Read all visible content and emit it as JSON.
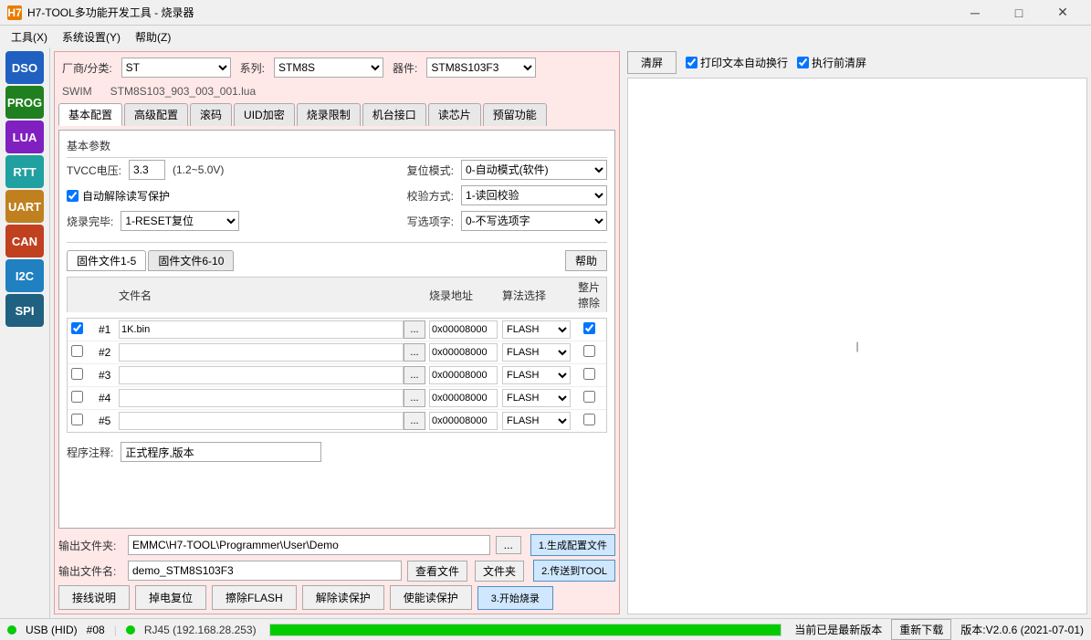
{
  "titleBar": {
    "icon": "H7",
    "title": "H7-TOOL多功能开发工具 - 烧录器",
    "minimizeLabel": "─",
    "maximizeLabel": "□",
    "closeLabel": "✕"
  },
  "menuBar": {
    "items": [
      "工具(X)",
      "系统设置(Y)",
      "帮助(Z)"
    ]
  },
  "sidebar": {
    "items": [
      {
        "label": "DSO",
        "color": "#2060c0"
      },
      {
        "label": "PROG",
        "color": "#208020"
      },
      {
        "label": "LUA",
        "color": "#8020c0"
      },
      {
        "label": "RTT",
        "color": "#20a0a0"
      },
      {
        "label": "UART",
        "color": "#c08020"
      },
      {
        "label": "CAN",
        "color": "#c04020"
      },
      {
        "label": "I2C",
        "color": "#2080c0"
      },
      {
        "label": "SPI",
        "color": "#206080"
      }
    ]
  },
  "deviceRow": {
    "vendorLabel": "厂商/分类:",
    "vendorValue": "ST",
    "seriesLabel": "系列:",
    "seriesValue": "STM8S",
    "deviceLabel": "器件:",
    "deviceValue": "STM8S103F3",
    "vendorOptions": [
      "ST"
    ],
    "seriesOptions": [
      "STM8S"
    ],
    "deviceOptions": [
      "STM8S103F3"
    ]
  },
  "swimRow": {
    "protocol": "SWIM",
    "filename": "STM8S103_903_003_001.lua"
  },
  "tabs": {
    "items": [
      "基本配置",
      "高级配置",
      "滚码",
      "UID加密",
      "烧录限制",
      "机台接口",
      "读芯片",
      "预留功能"
    ],
    "activeIndex": 0
  },
  "basicConfig": {
    "sectionTitle": "基本参数",
    "tvccLabel": "TVCC电压:",
    "tvccValue": "3.3",
    "tvccRange": "(1.2~5.0V)",
    "resetModeLabel": "复位模式:",
    "resetModeValue": "0-自动模式(软件)",
    "resetModeOptions": [
      "0-自动模式(软件)"
    ],
    "autoUnprotectLabel": "☑自动解除读写保护",
    "checksumLabel": "校验方式:",
    "checksumValue": "1-读回校验",
    "checksumOptions": [
      "1-读回校验"
    ],
    "burnCompleteLabel": "烧录完毕:",
    "burnCompleteValue": "1-RESET复位",
    "burnCompleteOptions": [
      "1-RESET复位"
    ],
    "writeOptionLabel": "写选项字:",
    "writeOptionValue": "0-不写选项字",
    "writeOptionOptions": [
      "0-不写选项字"
    ]
  },
  "fileTabs": {
    "items": [
      "固件文件1-5",
      "固件文件6-10"
    ],
    "activeIndex": 0,
    "helpLabel": "帮助"
  },
  "fileTable": {
    "headers": {
      "filename": "文件名",
      "address": "烧录地址",
      "algorithm": "算法选择",
      "eraseAll": "整片擦除"
    },
    "rows": [
      {
        "checked": true,
        "num": "#1",
        "file": "1K.bin",
        "address": "0x00008000",
        "algo": "FLASH",
        "erase": true
      },
      {
        "checked": false,
        "num": "#2",
        "file": "",
        "address": "0x00008000",
        "algo": "FLASH",
        "erase": false
      },
      {
        "checked": false,
        "num": "#3",
        "file": "",
        "address": "0x00008000",
        "algo": "FLASH",
        "erase": false
      },
      {
        "checked": false,
        "num": "#4",
        "file": "",
        "address": "0x00008000",
        "algo": "FLASH",
        "erase": false
      },
      {
        "checked": false,
        "num": "#5",
        "file": "",
        "address": "0x00008000",
        "algo": "FLASH",
        "erase": false
      }
    ],
    "algoOptions": [
      "FLASH"
    ]
  },
  "noteRow": {
    "label": "程序注释:",
    "value": "正式程序,版本"
  },
  "outputSection": {
    "folderLabel": "输出文件夹:",
    "folderValue": "EMMC\\H7-TOOL\\Programmer\\User\\Demo",
    "browseBtnLabel": "...",
    "fileNameLabel": "输出文件名:",
    "fileNameValue": "demo_STM8S103F3",
    "viewFileLabel": "查看文件",
    "openFolderLabel": "文件夹"
  },
  "actionButtons": {
    "wiring": "接线说明",
    "powerReset": "掉电复位",
    "eraseFlash": "擦除FLASH",
    "removeProtect": "解除读保护",
    "enableProtect": "使能读保护",
    "generateConfig": "1.生成配置文件",
    "sendToTool": "2.传送到TOOL",
    "startBurn": "3.开始烧录"
  },
  "rightPanel": {
    "clearBtnLabel": "清屏",
    "printAutoScrollLabel": "☑打印文本自动换行",
    "clearBeforeLabel": "☑执行前清屏",
    "outputContent": ""
  },
  "statusBar": {
    "usbLabel": "USB (HID)",
    "portLabel": "#08",
    "rj45Label": "RJ45 (192.168.28.253)",
    "progressText": "当前已是最新版本",
    "refreshLabel": "重新下载",
    "versionLabel": "版本:V2.0.6 (2021-07-01)"
  }
}
